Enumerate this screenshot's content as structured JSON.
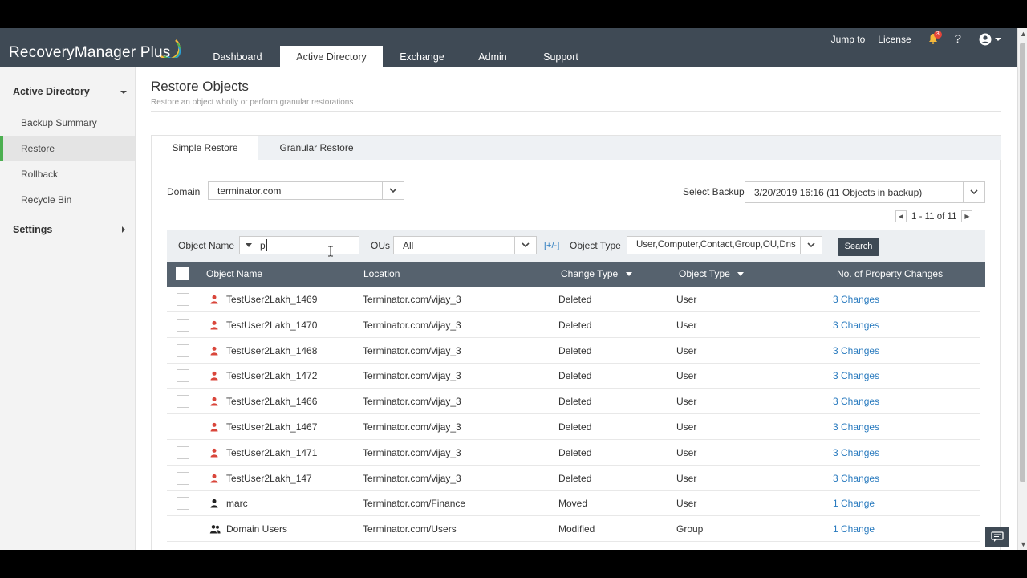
{
  "app": {
    "name": "RecoveryManager Plus"
  },
  "nav": {
    "tabs": [
      "Dashboard",
      "Active Directory",
      "Exchange",
      "Admin",
      "Support"
    ],
    "active": "Active Directory"
  },
  "topbar": {
    "jump_to": "Jump to",
    "license": "License",
    "notif_count": "3",
    "help": "?"
  },
  "sidebar": {
    "section1": "Active Directory",
    "items": [
      "Backup Summary",
      "Restore",
      "Rollback",
      "Recycle Bin"
    ],
    "active_item": "Restore",
    "section2": "Settings"
  },
  "page": {
    "title": "Restore Objects",
    "subtitle": "Restore an object wholly or perform granular restorations"
  },
  "tabs": {
    "simple": "Simple Restore",
    "granular": "Granular Restore"
  },
  "domain": {
    "label": "Domain",
    "value": "terminator.com"
  },
  "backup": {
    "label": "Select Backup",
    "value": "3/20/2019 16:16 (11 Objects in backup)"
  },
  "pager": {
    "range": "1 - 11 of 11"
  },
  "filter": {
    "object_name_label": "Object Name",
    "object_name_value": "p",
    "ous_label": "OUs",
    "ous_value": "All",
    "plus_minus": "[+/-]",
    "object_type_label": "Object Type",
    "object_type_value": "User,Computer,Contact,Group,OU,Dns",
    "search": "Search"
  },
  "table": {
    "columns": [
      "Object Name",
      "Location",
      "Change Type",
      "Object Type",
      "No. of Property Changes"
    ],
    "rows": [
      {
        "name": "TestUser2Lakh_1469",
        "location": "Terminator.com/vijay_3",
        "change": "Deleted",
        "type": "User",
        "changes": "3 Changes",
        "icon": "user-deleted-icon"
      },
      {
        "name": "TestUser2Lakh_1470",
        "location": "Terminator.com/vijay_3",
        "change": "Deleted",
        "type": "User",
        "changes": "3 Changes",
        "icon": "user-deleted-icon"
      },
      {
        "name": "TestUser2Lakh_1468",
        "location": "Terminator.com/vijay_3",
        "change": "Deleted",
        "type": "User",
        "changes": "3 Changes",
        "icon": "user-deleted-icon"
      },
      {
        "name": "TestUser2Lakh_1472",
        "location": "Terminator.com/vijay_3",
        "change": "Deleted",
        "type": "User",
        "changes": "3 Changes",
        "icon": "user-deleted-icon"
      },
      {
        "name": "TestUser2Lakh_1466",
        "location": "Terminator.com/vijay_3",
        "change": "Deleted",
        "type": "User",
        "changes": "3 Changes",
        "icon": "user-deleted-icon"
      },
      {
        "name": "TestUser2Lakh_1467",
        "location": "Terminator.com/vijay_3",
        "change": "Deleted",
        "type": "User",
        "changes": "3 Changes",
        "icon": "user-deleted-icon"
      },
      {
        "name": "TestUser2Lakh_1471",
        "location": "Terminator.com/vijay_3",
        "change": "Deleted",
        "type": "User",
        "changes": "3 Changes",
        "icon": "user-deleted-icon"
      },
      {
        "name": "TestUser2Lakh_147",
        "location": "Terminator.com/vijay_3",
        "change": "Deleted",
        "type": "User",
        "changes": "3 Changes",
        "icon": "user-deleted-icon"
      },
      {
        "name": "marc",
        "location": "Terminator.com/Finance",
        "change": "Moved",
        "type": "User",
        "changes": "1 Change",
        "icon": "user-icon"
      },
      {
        "name": "Domain Users",
        "location": "Terminator.com/Users",
        "change": "Modified",
        "type": "Group",
        "changes": "1 Change",
        "icon": "group-icon"
      }
    ]
  },
  "colors": {
    "header": "#3f4a55",
    "table_header": "#56626e",
    "accent_green": "#4caf50",
    "link": "#2a7bbf",
    "deleted_user": "#d9463b"
  }
}
